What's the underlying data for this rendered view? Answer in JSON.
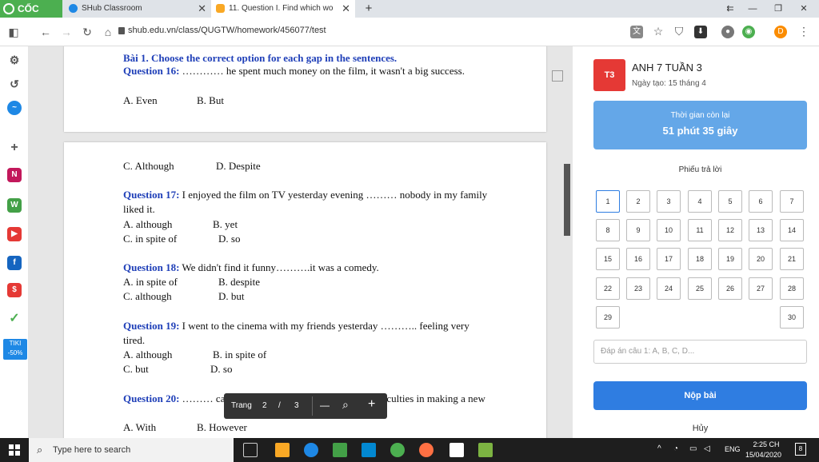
{
  "browser": {
    "brand": "CỐC CỐC",
    "tabs": [
      {
        "title": "SHub Classroom"
      },
      {
        "title": "11. Question I. Find which wo"
      }
    ],
    "url": "shub.edu.vn/class/QUGTW/homework/456077/test",
    "new_tab": "+",
    "window_controls": [
      "⇇",
      "—",
      "❐",
      "✕"
    ],
    "profile_initial": "D"
  },
  "document": {
    "section_header": "Bài 1. Choose the correct option for each gap in the sentences.",
    "q16": {
      "label": "Question 16:",
      "text": " ………… he spent much money on the film, it wasn't a big success.",
      "options": [
        "A. Even",
        "B. But"
      ]
    },
    "q16_cont_options": [
      "C. Although",
      "D. Despite"
    ],
    "q17": {
      "label": "Question 17:",
      "text": " I enjoyed the film on TV yesterday evening ……… nobody in my family liked it.",
      "options": [
        "A. although",
        "B. yet",
        "C. in spite of",
        "D. so"
      ]
    },
    "q18": {
      "label": "Question 18:",
      "text": " We didn't find it funny……….it was a comedy.",
      "options": [
        "A. in spite of",
        "B. despite",
        "C. although",
        "D. but"
      ]
    },
    "q19": {
      "label": "Question 19:",
      "text": " I went to the cinema with my friends yesterday ……….. feeling very tired.",
      "options": [
        "A. although",
        "B. in spite of",
        "C. but",
        "D. so"
      ]
    },
    "q20": {
      "label": "Question 20:",
      "text": " ……… careful preparation, we have a lot of difficulties in making a new",
      "options": [
        "A. With",
        "B. However"
      ]
    }
  },
  "page_toolbar": {
    "label": "Trang",
    "current": "2",
    "separator": "/",
    "total": "3",
    "zoom_out": "—",
    "zoom_in": "+"
  },
  "panel": {
    "avatar": "T3",
    "class_name": "ANH 7 TUẦN 3",
    "created": "Ngày tạo: 15 tháng 4",
    "timer_label": "Thời gian còn lại",
    "timer_value": "51 phút 35 giây",
    "answer_sheet": "Phiếu trả lời",
    "question_numbers": [
      "1",
      "2",
      "3",
      "4",
      "5",
      "6",
      "7",
      "8",
      "9",
      "10",
      "11",
      "12",
      "13",
      "14",
      "15",
      "16",
      "17",
      "18",
      "19",
      "20",
      "21",
      "22",
      "23",
      "24",
      "25",
      "26",
      "27",
      "28",
      "29",
      "30"
    ],
    "selected_question": "1",
    "answer_placeholder": "Đáp án câu 1: A, B, C, D...",
    "submit": "Nộp bài",
    "cancel": "Hủy"
  },
  "sidebar_badges": {
    "tiki": "TIKI",
    "discount": "-50%"
  },
  "taskbar": {
    "search_placeholder": "Type here to search",
    "language": "ENG",
    "time": "2:25 CH",
    "date": "15/04/2020",
    "notifications": "8"
  },
  "colors": {
    "accent": "#2f7de1",
    "timer_bg": "#64a7e8",
    "question_label": "#1f3fb8",
    "avatar_bg": "#e53935",
    "brand": "#4caf50"
  }
}
